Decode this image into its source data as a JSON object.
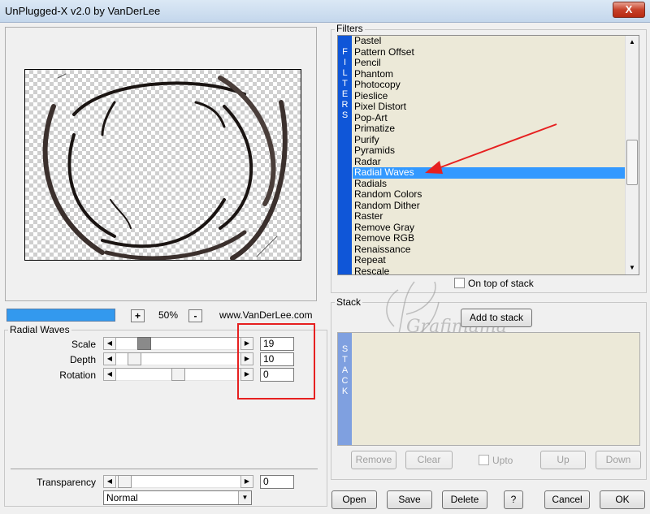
{
  "window": {
    "title": "UnPlugged-X v2.0 by VanDerLee",
    "close_glyph": "X"
  },
  "preview": {
    "zoom": "50%",
    "zoom_in": "+",
    "zoom_out": "-",
    "website": "www.VanDerLee.com"
  },
  "params": {
    "group_label": "Radial Waves",
    "sliders": [
      {
        "label": "Scale",
        "value": "19"
      },
      {
        "label": "Depth",
        "value": "10"
      },
      {
        "label": "Rotation",
        "value": "0"
      }
    ],
    "transparency": {
      "label": "Transparency",
      "value": "0"
    },
    "blend_mode": "Normal"
  },
  "filters": {
    "group_label": "Filters",
    "vertical_label": [
      "F",
      "I",
      "L",
      "T",
      "E",
      "R",
      "S"
    ],
    "items": [
      "Pastel",
      "Pattern Offset",
      "Pencil",
      "Phantom",
      "Photocopy",
      "Pieslice",
      "Pixel Distort",
      "Pop-Art",
      "Primatize",
      "Purify",
      "Pyramids",
      "Radar",
      "Radial Waves",
      "Radials",
      "Random Colors",
      "Random Dither",
      "Raster",
      "Remove Gray",
      "Remove RGB",
      "Renaissance",
      "Repeat",
      "Rescale"
    ],
    "selected": "Radial Waves",
    "on_top_label": "On top of stack"
  },
  "stack": {
    "group_label": "Stack",
    "add_label": "Add to stack",
    "vertical_label": [
      "S",
      "T",
      "A",
      "C",
      "K"
    ],
    "remove_label": "Remove",
    "clear_label": "Clear",
    "upto_label": "Upto",
    "up_label": "Up",
    "down_label": "Down"
  },
  "footer": {
    "open": "Open",
    "save": "Save",
    "delete": "Delete",
    "help": "?",
    "cancel": "Cancel",
    "ok": "OK"
  },
  "watermark": "Grafimama",
  "colors": {
    "selection": "#3399ff",
    "filters_bar": "#0f56d8",
    "stack_bar": "#7fa0e0",
    "annotation": "#e62020"
  }
}
